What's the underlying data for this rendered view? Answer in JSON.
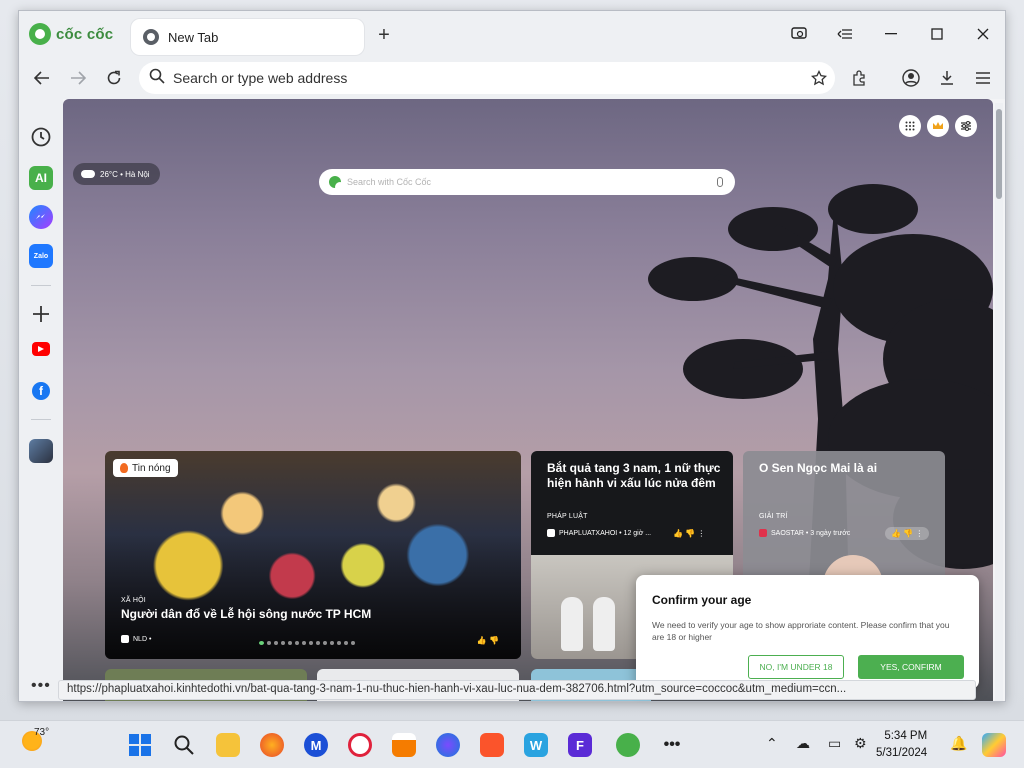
{
  "browser": {
    "brand": "cốc cốc",
    "tab_title": "New Tab",
    "omnibox_placeholder": "Search or type web address"
  },
  "sidebar": {
    "items": [
      "history-icon",
      "ai-assistant-icon",
      "messenger-icon",
      "zalo-icon",
      "add-icon",
      "youtube-icon",
      "facebook-icon",
      "profile-avatar-icon"
    ],
    "ai_label": "AI",
    "zalo_label": "Zalo"
  },
  "newtab": {
    "weather": "26°C • Hà Nội",
    "search_placeholder": "Search with Cốc Cốc"
  },
  "news": {
    "hot_badge": "Tin nóng",
    "hero": {
      "category": "XÃ HỘI",
      "title": "Người dân đổ về Lễ hội sông nước TP HCM",
      "source": "NLD •"
    },
    "card2": {
      "title": "Bắt quả tang 3 nam, 1 nữ thực hiện hành vi xấu lúc nửa đêm",
      "category": "PHÁP LUẬT",
      "source": "PHAPLUATXAHOI • 12 giờ ..."
    },
    "card3": {
      "title": "O Sen Ngọc Mai là ai",
      "category": "GIẢI TRÍ",
      "source": "SAOSTAR • 3 ngày trước"
    }
  },
  "age_dialog": {
    "title": "Confirm your age",
    "body": "We need to verify your age to show approriate content. Please confirm that you are 18 or higher",
    "no_label": "NO, I'M UNDER 18",
    "yes_label": "YES, CONFIRM"
  },
  "status_url": "https://phapluatxahoi.kinhtedothi.vn/bat-qua-tang-3-nam-1-nu-thuc-hien-hanh-vi-xau-luc-nua-dem-382706.html?utm_source=coccoc&utm_medium=ccn...",
  "taskbar": {
    "weather_temp": "73°",
    "time": "5:34 PM",
    "date": "5/31/2024"
  },
  "colors": {
    "brand_green": "#48b04a",
    "confirm_green": "#4caf50"
  }
}
